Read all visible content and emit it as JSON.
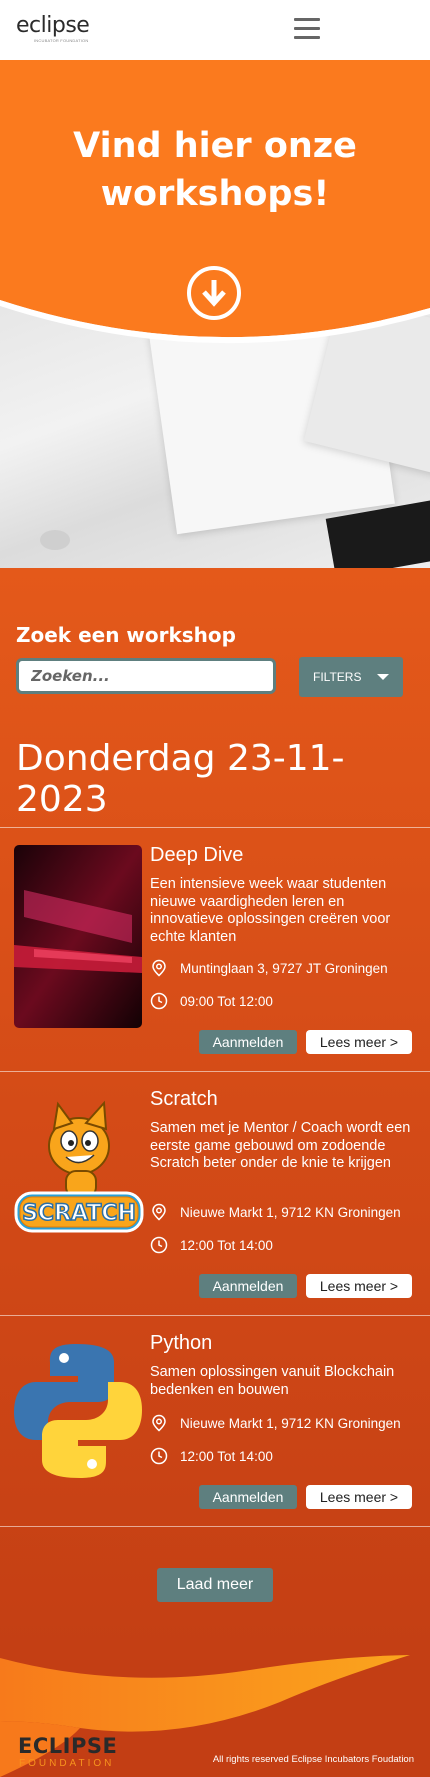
{
  "header": {
    "logo_text": "eclipse",
    "logo_sub": "INCUBATOR FOUNDATION"
  },
  "hero": {
    "title_line1": "Vind hier onze",
    "title_line2": "workshops!"
  },
  "search": {
    "label": "Zoek een workshop",
    "placeholder": "Zoeken...",
    "filters_label": "FILTERS"
  },
  "date_heading": "Donderdag 23-11-2023",
  "workshops": [
    {
      "title": "Deep Dive",
      "description": "Een intensieve week waar studenten nieuwe vaardigheden leren en innovatieve oplossingen creëren voor echte klanten",
      "location": "Muntinglaan 3, 9727 JT Groningen",
      "time": "09:00 Tot 12:00",
      "image": "laptop-photo"
    },
    {
      "title": "Scratch",
      "description": "Samen met je Mentor / Coach wordt een eerste game gebouwd om zodoende Scratch beter onder de knie te krijgen",
      "location": "Nieuwe Markt 1, 9712 KN Groningen",
      "time": "12:00 Tot 14:00",
      "image": "scratch-logo",
      "image_text": "SCRATCH"
    },
    {
      "title": "Python",
      "description": "Samen oplossingen vanuit Blockchain bedenken en bouwen",
      "location": "Nieuwe Markt 1, 9712 KN Groningen",
      "time": "12:00 Tot 14:00",
      "image": "python-logo"
    }
  ],
  "buttons": {
    "aanmelden": "Aanmelden",
    "lees_meer": "Lees meer >",
    "laad_meer": "Laad meer"
  },
  "footer": {
    "logo_main": "ECLIPSE",
    "logo_sub": "FOUNDATION",
    "copyright": "All rights reserved Eclipse Incubators Foudation"
  },
  "colors": {
    "orange": "#fb7a1e",
    "dark_orange": "#c43f14",
    "teal_button": "#5e7f7f",
    "white": "#ffffff"
  }
}
